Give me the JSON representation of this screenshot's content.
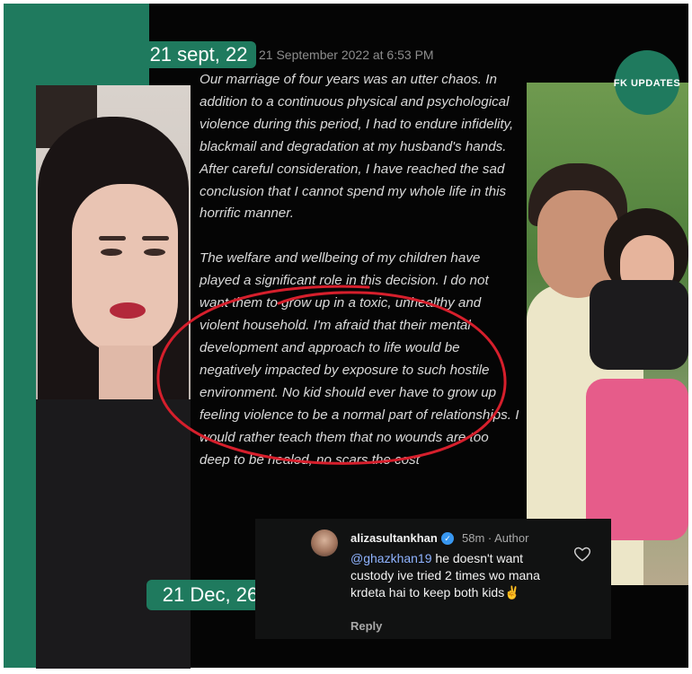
{
  "post": {
    "date_top": "21 sept, 22",
    "date_bottom": "21 Dec, 26",
    "timestamp": "21 September 2022 at 6:53 PM",
    "paragraph_1": "Our marriage of four years was an utter chaos. In addition to a continuous physical and psychological violence during this period, I had to endure infidelity, blackmail and degradation at my husband's hands. After careful consideration, I have reached the sad conclusion that I cannot spend my whole life in this horrific manner.",
    "paragraph_2": "The welfare and wellbeing of my children have played a significant role in this decision. I do not want them to grow up in a toxic, unhealthy and violent household. I'm afraid that their mental development and approach to life would be negatively impacted by exposure to such hostile environment. No kid should ever have to grow up feeling violence to be a normal part of relationships. I would rather teach them that no wounds are too deep to be healed, no scars the cost",
    "highlight_color": "#d61f2c"
  },
  "watermark": {
    "text": "FK UPDATES",
    "color": "#1f7a5e"
  },
  "comment": {
    "username": "alizasultankhan",
    "verified_icon": "verified-badge-icon",
    "meta": "58m · Author",
    "mention": "@ghazkhan19",
    "text": " he doesn't want custody ive tried 2 times  wo mana krdeta hai to keep both kids",
    "emoji": "✌️",
    "reply_label": "Reply",
    "like_icon": "heart-outline-icon"
  },
  "theme": {
    "accent": "#1f7a5e",
    "panel": "#050505"
  }
}
